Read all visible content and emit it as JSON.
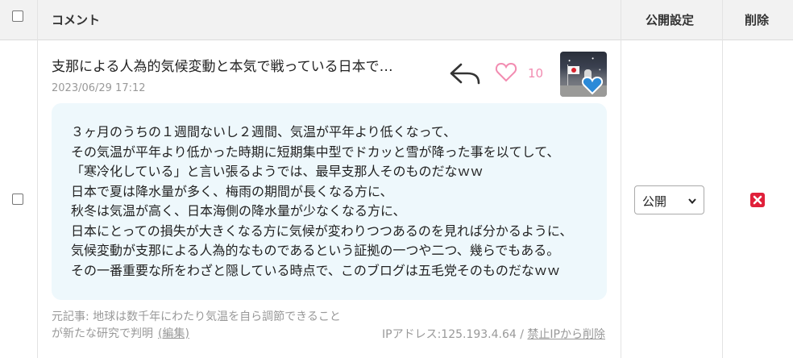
{
  "header": {
    "comment_label": "コメント",
    "publish_label": "公開設定",
    "delete_label": "削除"
  },
  "comment": {
    "title": "支那による人為的気候変動と本気で戦っている日本で…",
    "date": "2023/06/29 17:12",
    "like_count": "10",
    "body_lines": [
      "３ヶ月のうちの１週間ないし２週間、気温が平年より低くなって、",
      "その気温が平年より低かった時期に短期集中型でドカッと雪が降った事を以てして、",
      "「寒冷化している」と言い張るようでは、最早支那人そのものだなｗｗ",
      "日本で夏は降水量が多く、梅雨の期間が長くなる方に、",
      "秋冬は気温が高く、日本海側の降水量が少なくなる方に、",
      "日本にとっての損失が大きくなる方に気候が変わりつつあるのを見れば分かるように、",
      "気候変動が支那による人為的なものであるという証拠の一つや二つ、幾らでもある。",
      "その一番重要な所をわざと隠している時点で、このブログは五毛党そのものだなｗｗ"
    ],
    "source_line1": "元記事: 地球は数千年にわたり気温を自ら調節できること",
    "source_line2": "が新たな研究で判明",
    "edit_label": "(編集)",
    "ip_label": "IPアドレス:125.193.4.64 / ",
    "ban_label": "禁止IPから削除",
    "visibility_value": "公開"
  },
  "colors": {
    "header_bg": "#f2f2f2",
    "bubble_bg": "#eef8fc",
    "like_pink": "#f28cb1",
    "delete_red": "#e0203a",
    "muted_text": "#999999"
  },
  "icons": {
    "reply": "reply-arrow-icon",
    "like": "heart-outline-icon",
    "avatar_badge": "heart-badge-icon",
    "delete": "delete-x-icon",
    "select": "chevron-down-icon"
  }
}
